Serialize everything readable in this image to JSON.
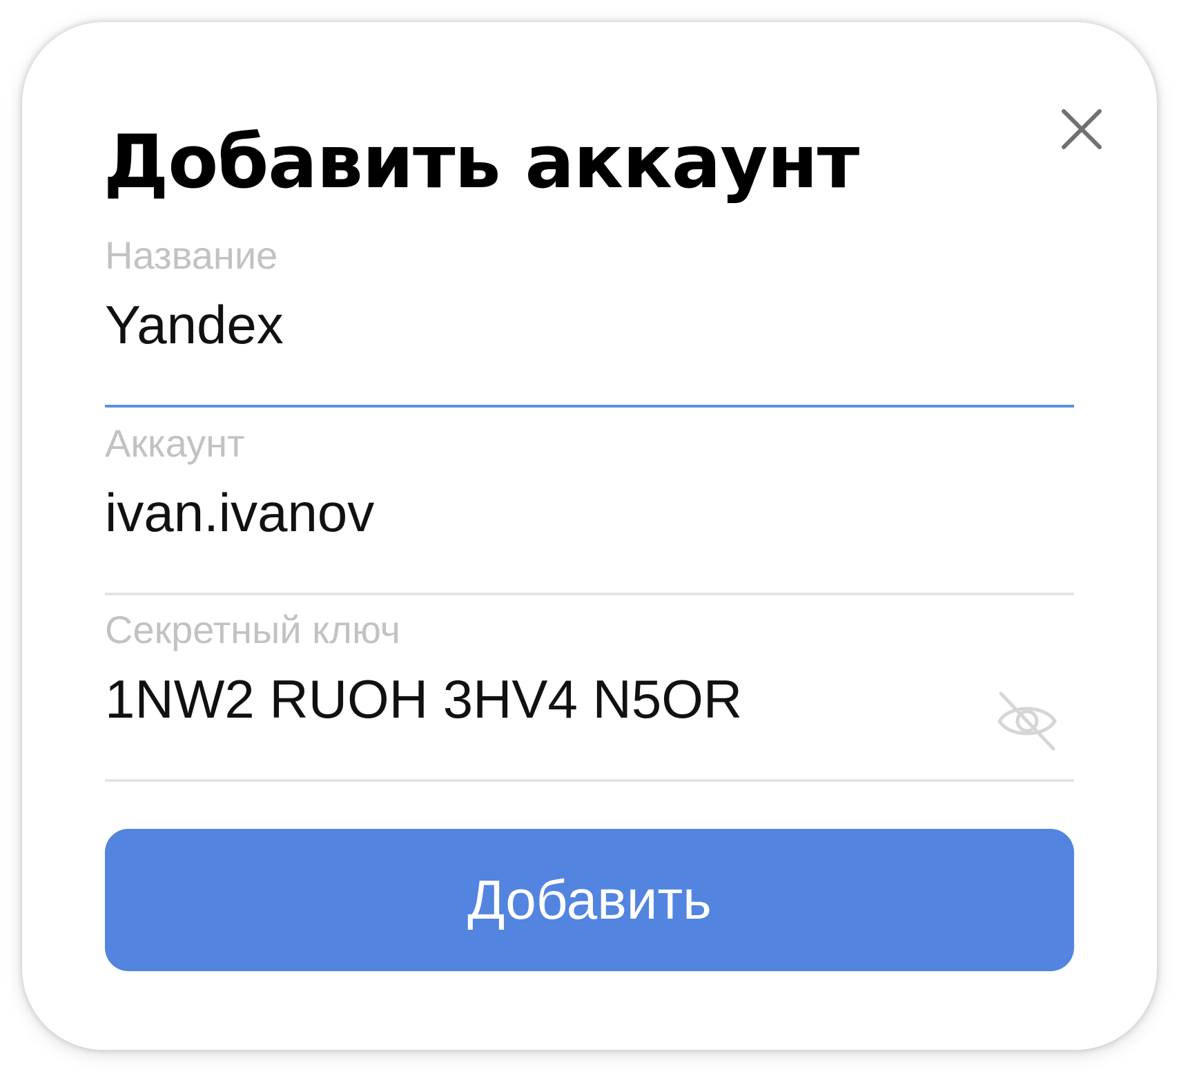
{
  "dialog": {
    "title": "Добавить аккаунт",
    "close_icon": "close-icon",
    "fields": {
      "name": {
        "label": "Название",
        "value": "Yandex",
        "focused": true
      },
      "account": {
        "label": "Аккаунт",
        "value": "ivan.ivanov"
      },
      "secret": {
        "label": "Секретный ключ",
        "value": "1NW2 RUOH 3HV4 N5OR",
        "visibility_icon": "eye-off-icon"
      }
    },
    "submit_label": "Добавить"
  },
  "colors": {
    "accent": "#5284e0",
    "focus_underline": "#5e8ee6",
    "label": "#c2c2c2",
    "divider": "#e4e4e4",
    "text": "#111111"
  }
}
